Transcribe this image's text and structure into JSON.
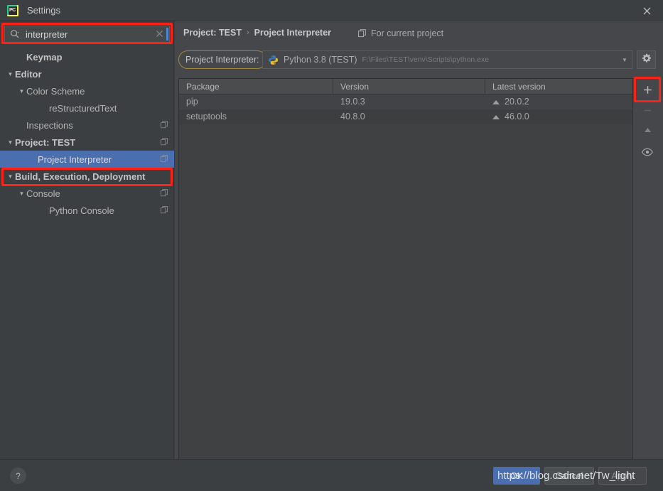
{
  "window": {
    "title": "Settings",
    "app_icon": "pycharm-logo-icon",
    "logo_text": "PC",
    "close_icon": "close-icon"
  },
  "search": {
    "value": "interpreter",
    "placeholder": "",
    "icon": "search-icon",
    "clear_icon": "clear-icon"
  },
  "sidebar": {
    "items": [
      {
        "label": "Keymap",
        "indent": 1,
        "arrow": "",
        "bold": true,
        "selected": false,
        "copy_icon": false
      },
      {
        "label": "Editor",
        "indent": 0,
        "arrow": "▼",
        "bold": true,
        "selected": false,
        "copy_icon": false
      },
      {
        "label": "Color Scheme",
        "indent": 1,
        "arrow": "▼",
        "bold": false,
        "selected": false,
        "copy_icon": false
      },
      {
        "label": "reStructuredText",
        "indent": 3,
        "arrow": "",
        "bold": false,
        "selected": false,
        "copy_icon": false
      },
      {
        "label": "Inspections",
        "indent": 1,
        "arrow": "",
        "bold": false,
        "selected": false,
        "copy_icon": true
      },
      {
        "label": "Project: TEST",
        "indent": 0,
        "arrow": "▼",
        "bold": true,
        "selected": false,
        "copy_icon": true
      },
      {
        "label": "Project Interpreter",
        "indent": 2,
        "arrow": "",
        "bold": false,
        "selected": true,
        "copy_icon": true
      },
      {
        "label": "Build, Execution, Deployment",
        "indent": 0,
        "arrow": "▼",
        "bold": true,
        "selected": false,
        "copy_icon": false
      },
      {
        "label": "Console",
        "indent": 1,
        "arrow": "▼",
        "bold": false,
        "selected": false,
        "copy_icon": true
      },
      {
        "label": "Python Console",
        "indent": 3,
        "arrow": "",
        "bold": false,
        "selected": false,
        "copy_icon": true
      }
    ]
  },
  "main": {
    "breadcrumb": {
      "parent": "Project: TEST",
      "separator": "›",
      "current": "Project Interpreter"
    },
    "scope": {
      "icon": "copy-scope-icon",
      "label": "For current project"
    },
    "interpreter": {
      "label": "Project Interpreter:",
      "icon": "python-icon",
      "name": "Python 3.8 (TEST)",
      "path": "F:\\Files\\TEST\\venv\\Scripts\\python.exe",
      "dropdown_icon": "chevron-down-icon",
      "settings_icon": "gear-icon"
    },
    "table": {
      "columns": [
        "Package",
        "Version",
        "Latest version"
      ],
      "rows": [
        {
          "package": "pip",
          "version": "19.0.3",
          "latest": "20.0.2",
          "upgrade_icon": "up-triangle-icon"
        },
        {
          "package": "setuptools",
          "version": "40.8.0",
          "latest": "46.0.0",
          "upgrade_icon": "up-triangle-icon"
        }
      ]
    },
    "tools": [
      {
        "name": "add-package-button",
        "glyph": "+",
        "icon": "plus-icon"
      },
      {
        "name": "remove-package-button",
        "glyph": "−",
        "icon": "minus-icon"
      },
      {
        "name": "upgrade-package-button",
        "glyph": "▲",
        "icon": "up-triangle-icon"
      },
      {
        "name": "show-early-releases-button",
        "glyph": "◉",
        "icon": "eye-icon"
      }
    ]
  },
  "footer": {
    "help_label": "?",
    "help_icon": "help-icon",
    "ok_label": "OK",
    "cancel_label": "Cancel",
    "apply_label": "Apply"
  },
  "overlay": {
    "watermark": "https://blog.csdn.net/Tw_light"
  },
  "colors": {
    "window_bg": "#3c3f41",
    "panel_bg": "#45474a",
    "selection_blue": "#4b6eaf",
    "highlight_red": "#ff2116",
    "table_bg": "#3f4143",
    "pill_border": "#a0873f"
  }
}
